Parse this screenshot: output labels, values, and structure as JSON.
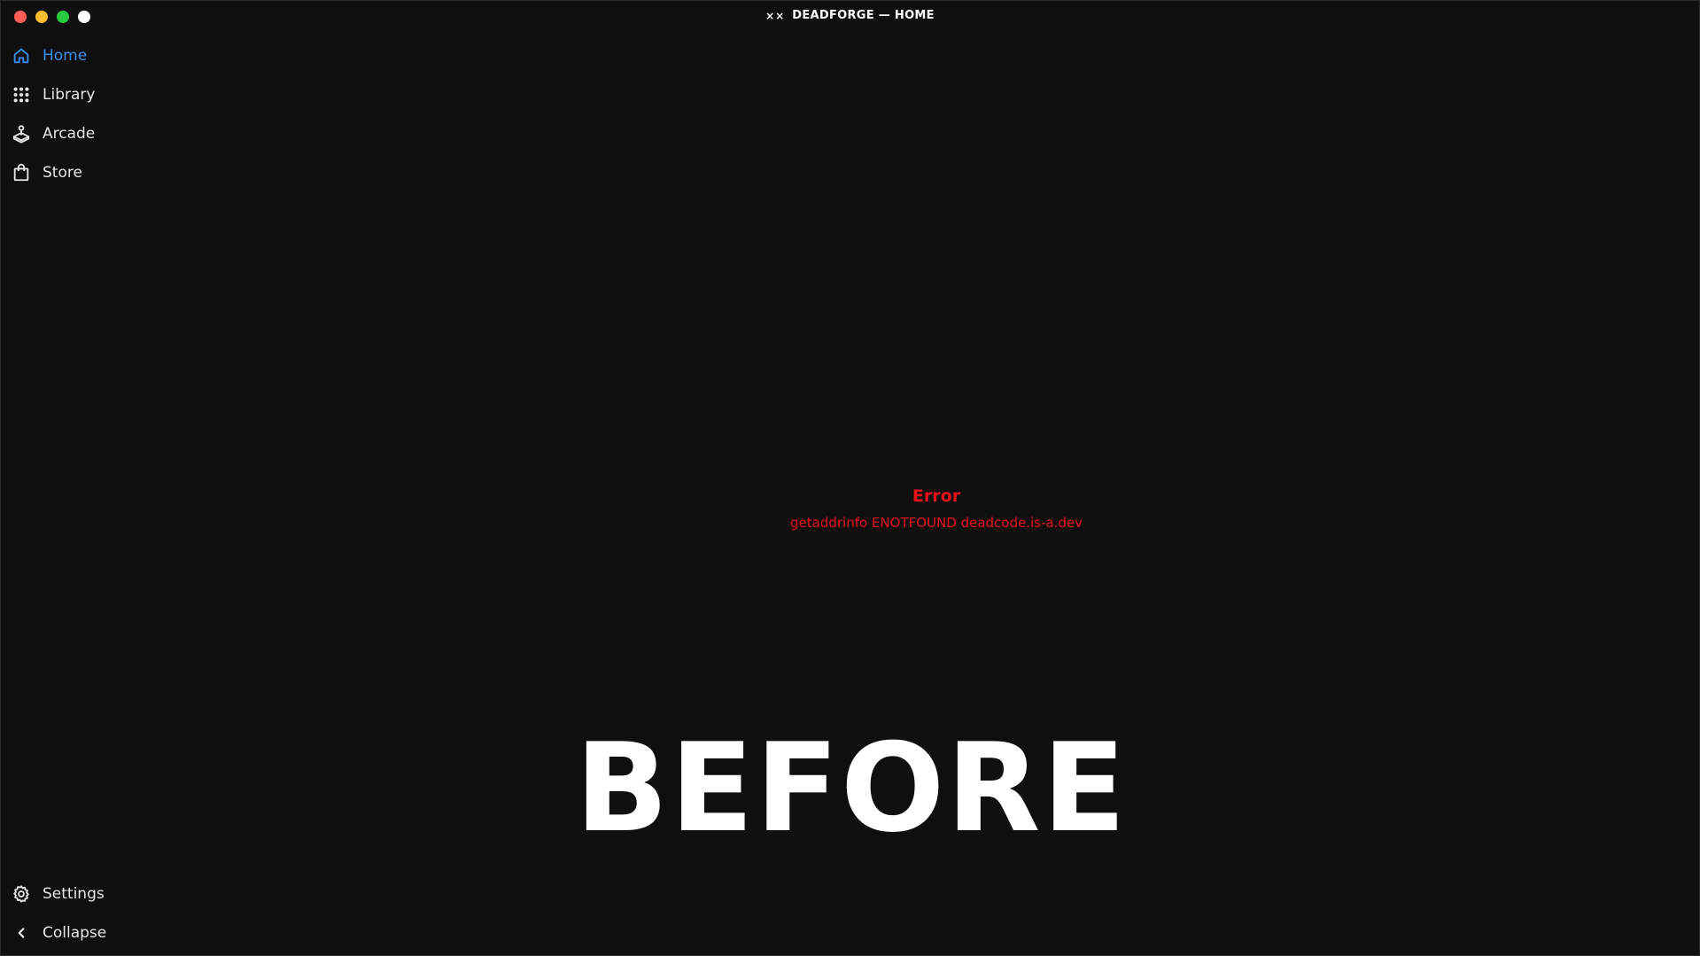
{
  "window": {
    "title": "DEADFORGE — HOME",
    "logo": "××"
  },
  "sidebar": {
    "items": [
      {
        "label": "Home",
        "icon": "home-icon",
        "active": true
      },
      {
        "label": "Library",
        "icon": "grid-icon",
        "active": false
      },
      {
        "label": "Arcade",
        "icon": "joystick-icon",
        "active": false
      },
      {
        "label": "Store",
        "icon": "shopping-bag-icon",
        "active": false
      }
    ],
    "bottom": [
      {
        "label": "Settings",
        "icon": "gear-icon"
      },
      {
        "label": "Collapse",
        "icon": "chevron-left-icon"
      }
    ]
  },
  "main": {
    "error_title": "Error",
    "error_message": "getaddrinfo ENOTFOUND deadcode.is-a.dev",
    "overlay_text": "BEFORE"
  },
  "colors": {
    "background": "#0f0f10",
    "accent": "#3b8eea",
    "error": "#e8101c"
  }
}
